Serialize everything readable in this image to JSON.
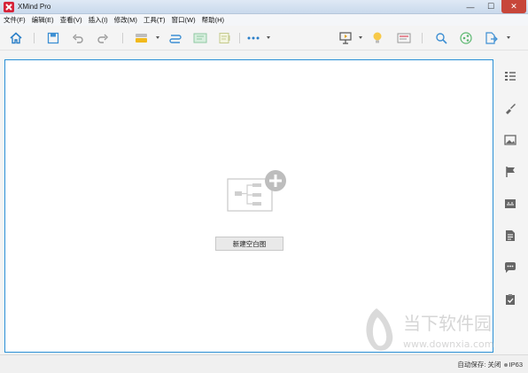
{
  "window": {
    "title": "XMind Pro",
    "controls": {
      "minimize": "—",
      "maximize": "☐",
      "close": "✕"
    }
  },
  "menu": {
    "items": [
      "文件(F)",
      "编辑(E)",
      "查看(V)",
      "插入(I)",
      "修改(M)",
      "工具(T)",
      "窗口(W)",
      "帮助(H)"
    ]
  },
  "toolbar": {
    "icons": [
      "home-icon",
      "save-icon",
      "undo-icon",
      "redo-icon",
      "topic-icon",
      "relationship-icon",
      "summary-icon",
      "boundary-icon",
      "more-icon",
      "presentation-icon",
      "idea-icon",
      "outline-icon",
      "search-icon",
      "share-icon",
      "export-icon"
    ]
  },
  "canvas": {
    "new_blank_label": "新建空白图",
    "border_color": "#2a8fd6"
  },
  "right_panel": {
    "icons": [
      "outline-panel-icon",
      "format-brush-icon",
      "image-icon",
      "marker-flag-icon",
      "notes-icon",
      "document-icon",
      "comment-icon",
      "task-icon"
    ]
  },
  "status": {
    "autosave": "自动保存: 关闭",
    "account": "IP63"
  },
  "watermark": {
    "brand": "当下软件园",
    "url": "www.downxia.com"
  },
  "colors": {
    "accent": "#2a8fd6",
    "logo": "#d6243a",
    "close_button": "#c7463a"
  }
}
